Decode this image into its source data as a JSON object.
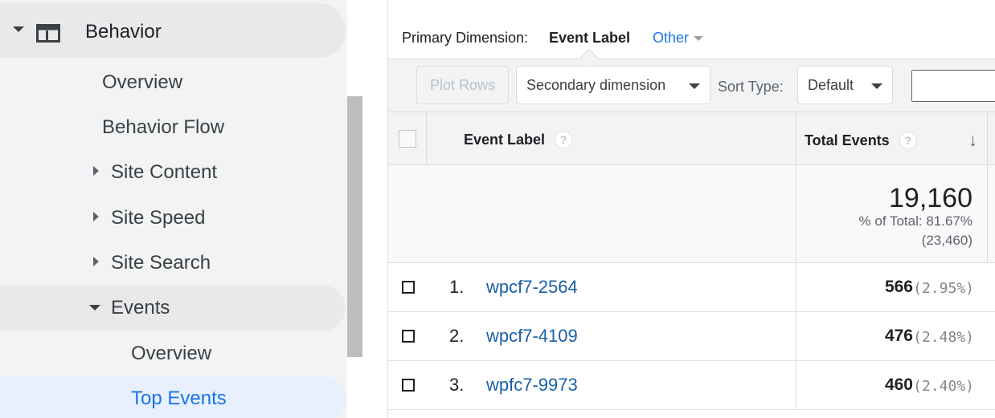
{
  "sidebar": {
    "behavior_label": "Behavior",
    "overview_label": "Overview",
    "behavior_flow_label": "Behavior Flow",
    "site_content_label": "Site Content",
    "site_speed_label": "Site Speed",
    "site_search_label": "Site Search",
    "events_label": "Events",
    "events_overview_label": "Overview",
    "top_events_label": "Top Events",
    "icons": {
      "behavior": "browser-window-icon",
      "collapse": "caret-down-icon",
      "expand": "caret-right-icon"
    },
    "active_color": "#1a73e8"
  },
  "dimension": {
    "prefix": "Primary Dimension:",
    "active": "Event Label",
    "other": "Other"
  },
  "toolbar": {
    "plot_rows": "Plot Rows",
    "secondary_dimension": "Secondary dimension",
    "sort_type_label": "Sort Type:",
    "sort_type_value": "Default",
    "search_value": ""
  },
  "table": {
    "columns": {
      "label": "Event Label",
      "total": "Total Events",
      "help_icon": "?"
    },
    "totals": {
      "value": "19,160",
      "pct_of_total": "% of Total: 81.67%",
      "absolute": "(23,460)"
    },
    "rows": [
      {
        "num": "1.",
        "label": "wpcf7-2564",
        "value": "566",
        "pct": "(2.95%)"
      },
      {
        "num": "2.",
        "label": "wpcf7-4109",
        "value": "476",
        "pct": "(2.48%)"
      },
      {
        "num": "3.",
        "label": "wpfc7-9973",
        "value": "460",
        "pct": "(2.40%)"
      }
    ]
  }
}
